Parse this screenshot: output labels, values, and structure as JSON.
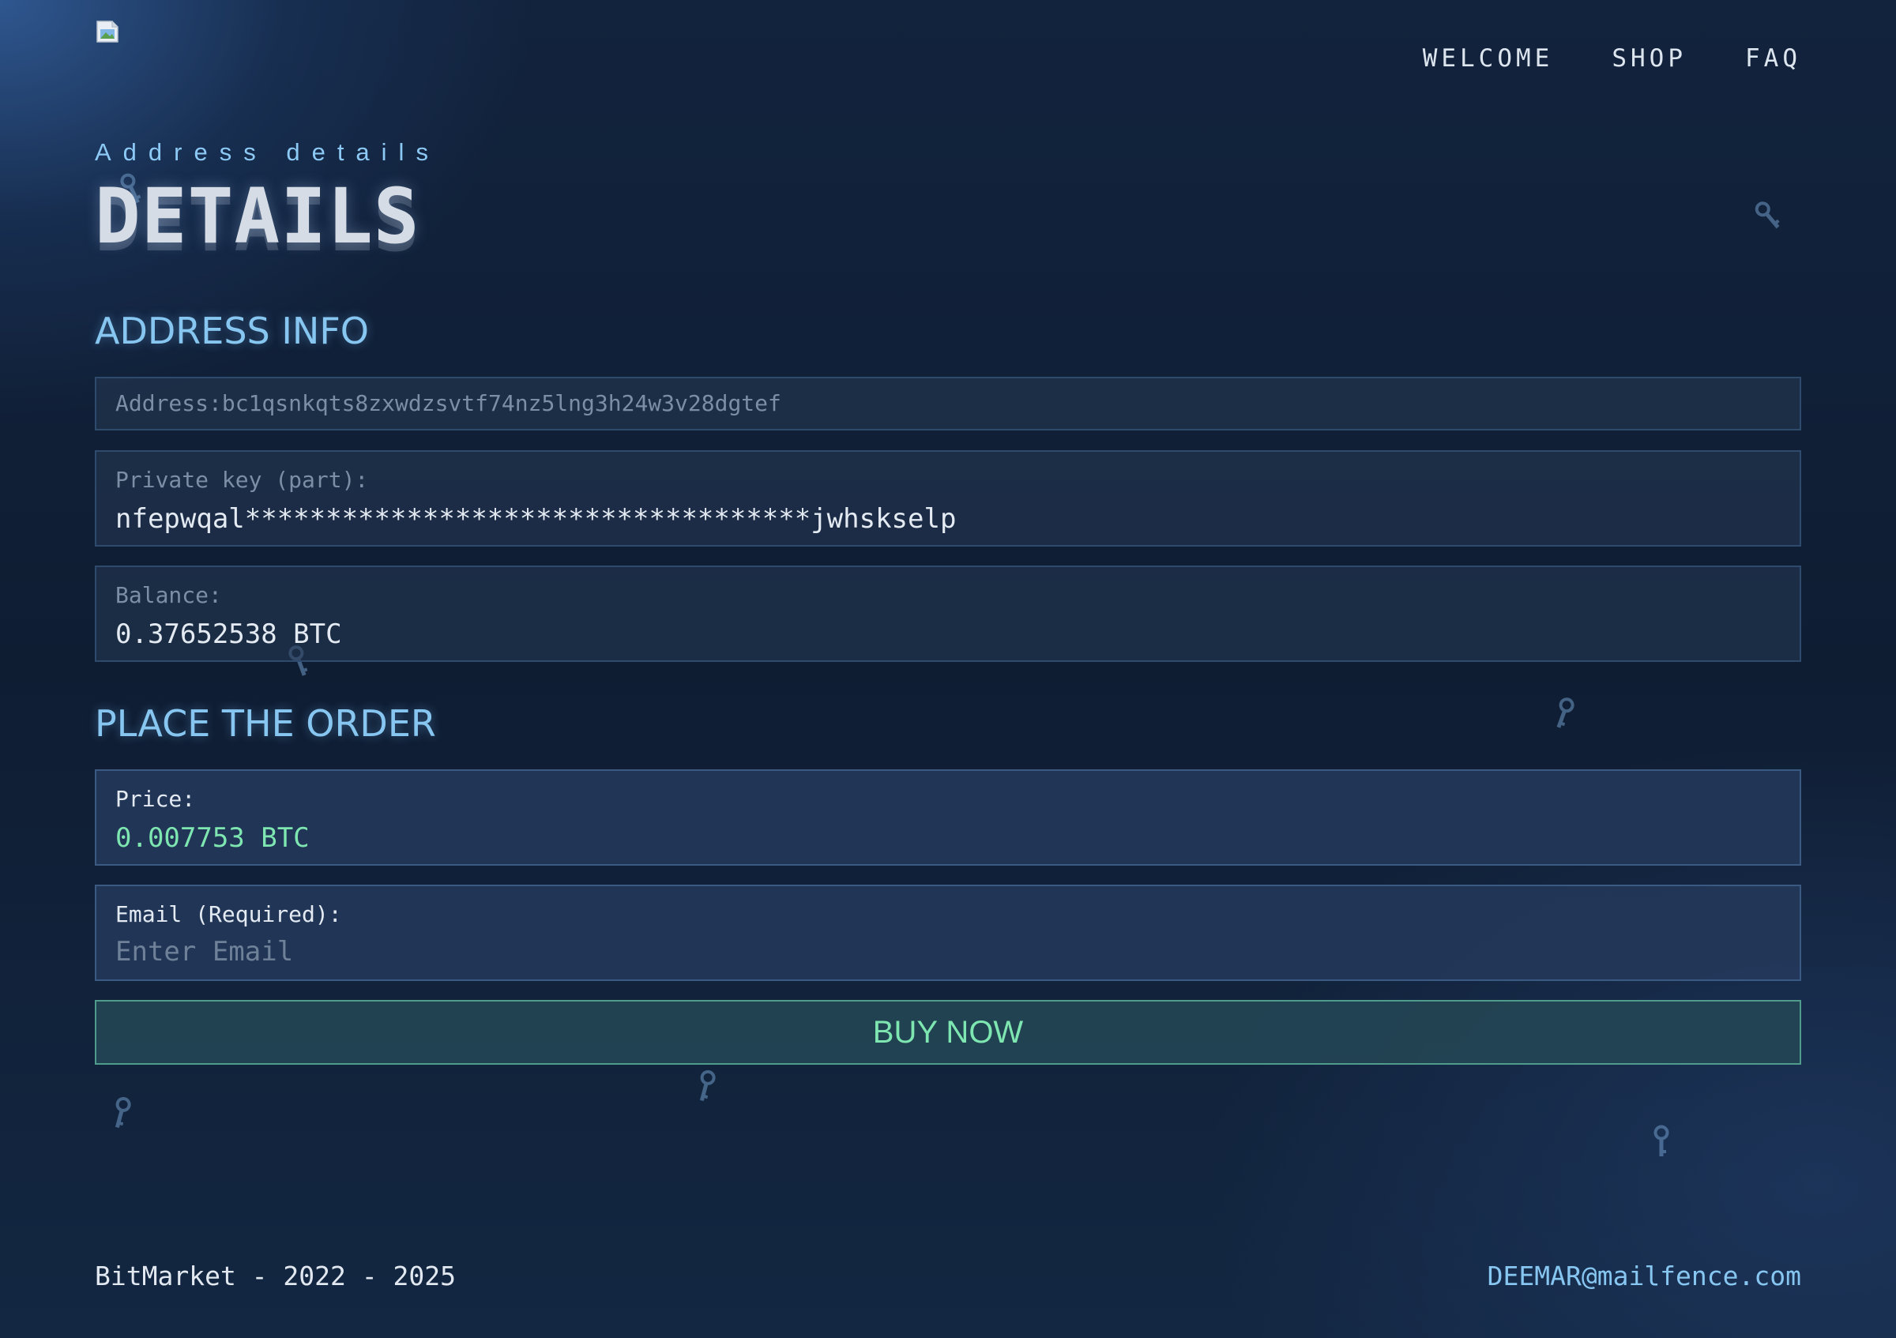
{
  "header": {
    "logo_icon": "broken-image-icon",
    "nav": [
      {
        "label": "WELCOME"
      },
      {
        "label": "SHOP"
      },
      {
        "label": "FAQ"
      }
    ]
  },
  "hero": {
    "kicker": "Address details",
    "title": "DETAILS"
  },
  "address_info": {
    "heading": "ADDRESS INFO",
    "address_text": "Address:bc1qsnkqts8zxwdzsvtf74nz5lng3h24w3v28dgtef",
    "private_key_label": "Private key (part):",
    "private_key_value": "nfepwqal***********************************jwhskselp",
    "balance_label": "Balance:",
    "balance_value": "0.37652538 BTC"
  },
  "order": {
    "heading": "PLACE THE ORDER",
    "price_label": "Price:",
    "price_value": "0.007753 BTC",
    "email_label": "Email (Required):",
    "email_placeholder": "Enter Email",
    "email_value": "",
    "buy_label": "BUY NOW"
  },
  "footer": {
    "copyright": "BitMarket - 2022 - 2025",
    "contact_email": "DEEMAR@mailfence.com"
  },
  "decorations": {
    "icon": "key-icon"
  },
  "colors": {
    "background": "#0f1d33",
    "accent_blue": "#86c6f0",
    "accent_green": "#7ee6b0",
    "field_border": "#2e4a6d"
  }
}
